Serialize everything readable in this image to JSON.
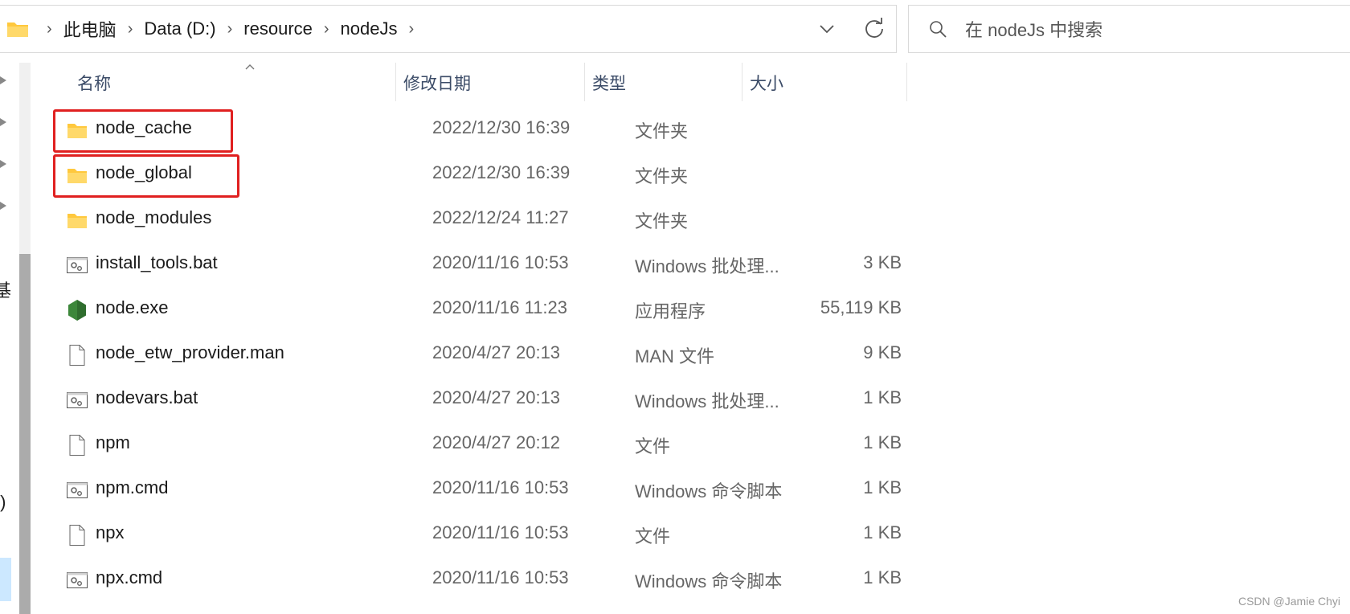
{
  "address_bar": {
    "breadcrumbs": [
      "此电脑",
      "Data (D:)",
      "resource",
      "nodeJs"
    ],
    "separator": "›"
  },
  "search": {
    "placeholder": "在 nodeJs 中搜索"
  },
  "nav": {
    "partial_labels": [
      "基",
      ":)"
    ]
  },
  "columns": {
    "name": "名称",
    "date": "修改日期",
    "type": "类型",
    "size": "大小"
  },
  "files": [
    {
      "name": "node_cache",
      "date": "2022/12/30 16:39",
      "type": "文件夹",
      "size": "",
      "icon": "folder-icon",
      "highlighted": true
    },
    {
      "name": "node_global",
      "date": "2022/12/30 16:39",
      "type": "文件夹",
      "size": "",
      "icon": "folder-icon",
      "highlighted": true
    },
    {
      "name": "node_modules",
      "date": "2022/12/24 11:27",
      "type": "文件夹",
      "size": "",
      "icon": "folder-icon",
      "highlighted": false
    },
    {
      "name": "install_tools.bat",
      "date": "2020/11/16 10:53",
      "type": "Windows 批处理...",
      "size": "3 KB",
      "icon": "batch-file-icon",
      "highlighted": false
    },
    {
      "name": "node.exe",
      "date": "2020/11/16 11:23",
      "type": "应用程序",
      "size": "55,119 KB",
      "icon": "nodejs-app-icon",
      "highlighted": false
    },
    {
      "name": "node_etw_provider.man",
      "date": "2020/4/27 20:13",
      "type": "MAN 文件",
      "size": "9 KB",
      "icon": "file-icon",
      "highlighted": false
    },
    {
      "name": "nodevars.bat",
      "date": "2020/4/27 20:13",
      "type": "Windows 批处理...",
      "size": "1 KB",
      "icon": "batch-file-icon",
      "highlighted": false
    },
    {
      "name": "npm",
      "date": "2020/4/27 20:12",
      "type": "文件",
      "size": "1 KB",
      "icon": "file-icon",
      "highlighted": false
    },
    {
      "name": "npm.cmd",
      "date": "2020/11/16 10:53",
      "type": "Windows 命令脚本",
      "size": "1 KB",
      "icon": "batch-file-icon",
      "highlighted": false
    },
    {
      "name": "npx",
      "date": "2020/11/16 10:53",
      "type": "文件",
      "size": "1 KB",
      "icon": "file-icon",
      "highlighted": false
    },
    {
      "name": "npx.cmd",
      "date": "2020/11/16 10:53",
      "type": "Windows 命令脚本",
      "size": "1 KB",
      "icon": "batch-file-icon",
      "highlighted": false
    }
  ],
  "colors": {
    "highlight_border": "#e02020",
    "folder_yellow": "#ffc83d",
    "node_green": "#3c873a",
    "header_text": "#3b4b67"
  },
  "watermark": "CSDN @Jamie Chyi"
}
